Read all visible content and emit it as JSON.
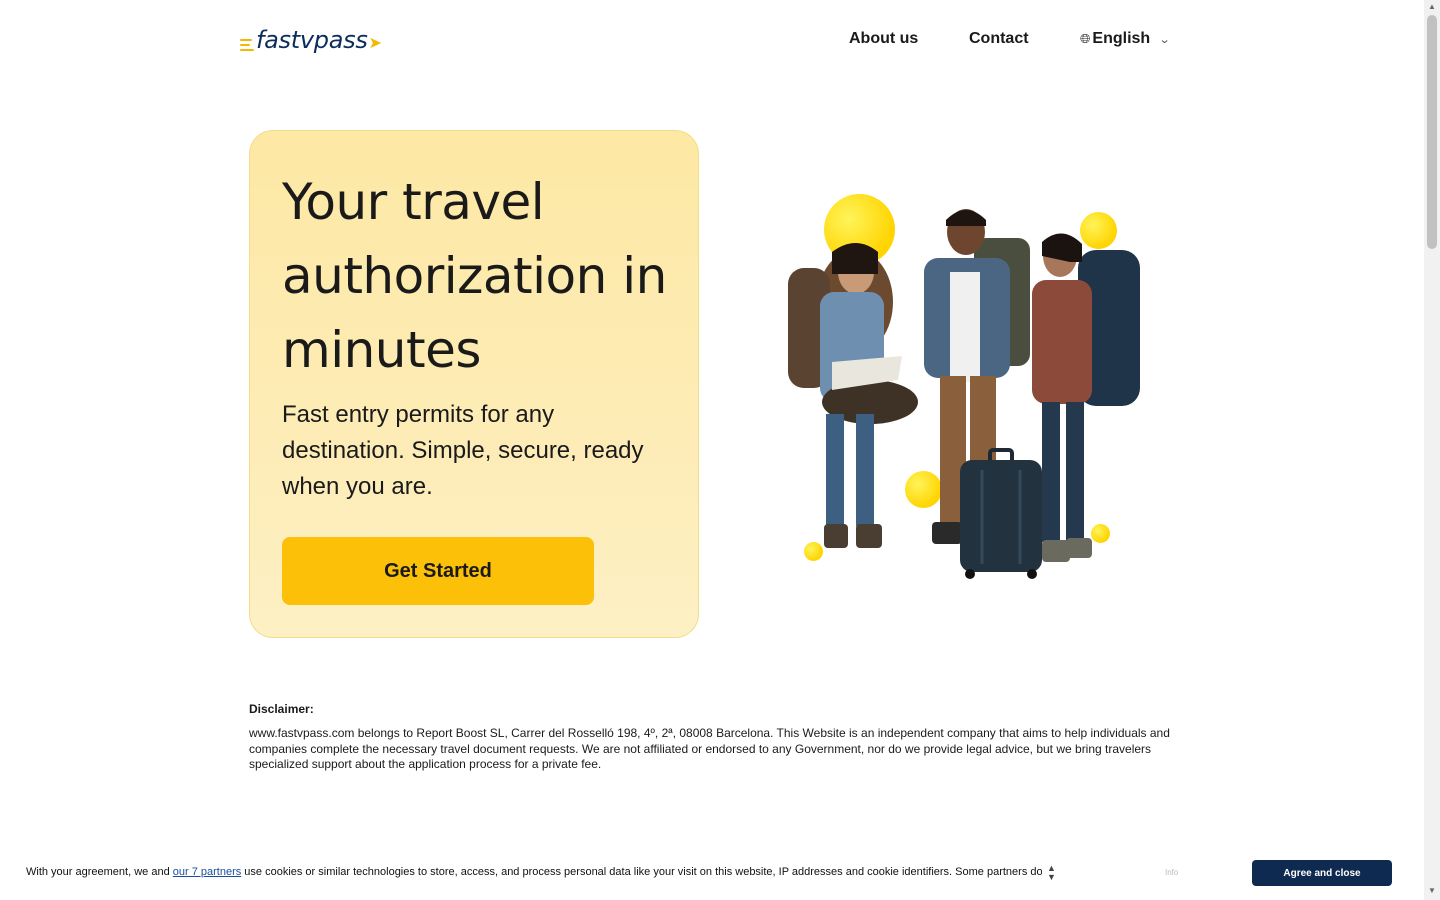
{
  "header": {
    "logo_text": "fastvpass",
    "nav": {
      "about": "About us",
      "contact": "Contact",
      "language": "English"
    }
  },
  "hero": {
    "title": "Your travel authorization in minutes",
    "subtitle": "Fast entry permits for any destination. Simple, secure, ready when you are.",
    "cta_label": "Get Started"
  },
  "disclaimer": {
    "title": "Disclaimer:",
    "text": "www.fastvpass.com belongs to Report Boost SL, Carrer del Rosselló 198, 4º, 2ª, 08008 Barcelona. This Website is an independent company that aims to help individuals and companies complete the necessary travel document requests. We are not affiliated or endorsed to any Government, nor do we provide legal advice, but we bring travelers specialized support about the application process for a private fee."
  },
  "cookie_banner": {
    "text_before": "With your agreement, we and ",
    "partners_link": "our 7 partners",
    "text_after": " use cookies or similar technologies to store, access, and process personal data like your visit on this website, IP addresses and cookie identifiers. Some partners do",
    "info_label": "Info",
    "agree_label": "Agree and close"
  },
  "colors": {
    "accent": "#fdc009",
    "hero_bg": "#fde8a4",
    "brand_navy": "#0d2d5e",
    "agree_button": "#0e2a50"
  }
}
